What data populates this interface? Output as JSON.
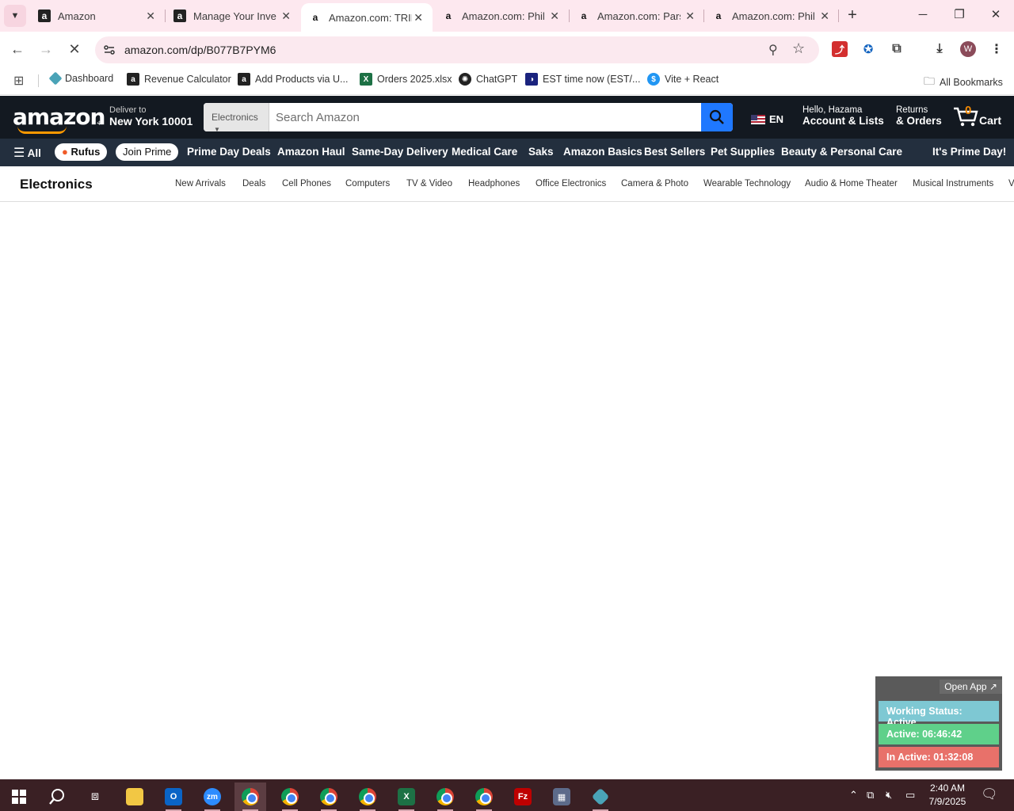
{
  "browser": {
    "tabs": [
      {
        "title": "Amazon",
        "favicon": "amazon-a"
      },
      {
        "title": "Manage Your Inventory",
        "favicon": "amazon-a"
      },
      {
        "title": "Amazon.com: TRIP",
        "favicon": "amazon-small"
      },
      {
        "title": "Amazon.com: Phil",
        "favicon": "amazon-small"
      },
      {
        "title": "Amazon.com: Pars",
        "favicon": "amazon-small"
      },
      {
        "title": "Amazon.com: Phil",
        "favicon": "amazon-small"
      }
    ],
    "active_tab_index": 2,
    "url": "amazon.com/dp/B077B7PYM6",
    "profile_initial": "W"
  },
  "bookmarks": {
    "items": [
      {
        "label": "Dashboard",
        "icon": "dashboard-icon"
      },
      {
        "label": "Revenue Calculator",
        "icon": "amazon-icon"
      },
      {
        "label": "Add Products via U...",
        "icon": "amazon-icon"
      },
      {
        "label": "Orders 2025.xlsx",
        "icon": "excel-icon"
      },
      {
        "label": "ChatGPT",
        "icon": "chatgpt-icon"
      },
      {
        "label": "EST time now (EST/...",
        "icon": "clock-site-icon"
      },
      {
        "label": "Vite + React",
        "icon": "vite-icon"
      }
    ],
    "all_bookmarks_label": "All Bookmarks"
  },
  "amazon": {
    "logo_text": "amazon",
    "deliver_line1": "Deliver to",
    "deliver_line2": "New York 10001",
    "search_category": "Electronics",
    "search_placeholder": "Search Amazon",
    "language": "EN",
    "account_line1": "Hello, Hazama",
    "account_line2": "Account & Lists",
    "returns_line1": "Returns",
    "returns_line2": "& Orders",
    "cart_count": "0",
    "cart_label": "Cart"
  },
  "nav": {
    "all_label": "All",
    "rufus_label": "Rufus",
    "join_prime_label": "Join Prime",
    "items": [
      "Prime Day Deals",
      "Amazon Haul",
      "Same-Day Delivery",
      "Medical Care",
      "Saks",
      "Amazon Basics",
      "Best Sellers",
      "Pet Supplies",
      "Beauty & Personal Care"
    ],
    "promo": "It's Prime Day!"
  },
  "subnav": {
    "title": "Electronics",
    "links": [
      "New Arrivals",
      "Deals",
      "Cell Phones",
      "Computers",
      "TV & Video",
      "Headphones",
      "Office Electronics",
      "Camera & Photo",
      "Wearable Technology",
      "Audio & Home Theater",
      "Musical Instruments",
      "V"
    ]
  },
  "widget": {
    "open_app": "Open App ↗",
    "status": "Working Status: Active",
    "active": "Active: 06:46:42",
    "inactive": "In Active: 01:32:08",
    "colors": {
      "status": "#7ec8d3",
      "active": "#5fd08a",
      "inactive": "#e8716a"
    }
  },
  "taskbar": {
    "time": "2:40 AM",
    "date": "7/9/2025"
  }
}
